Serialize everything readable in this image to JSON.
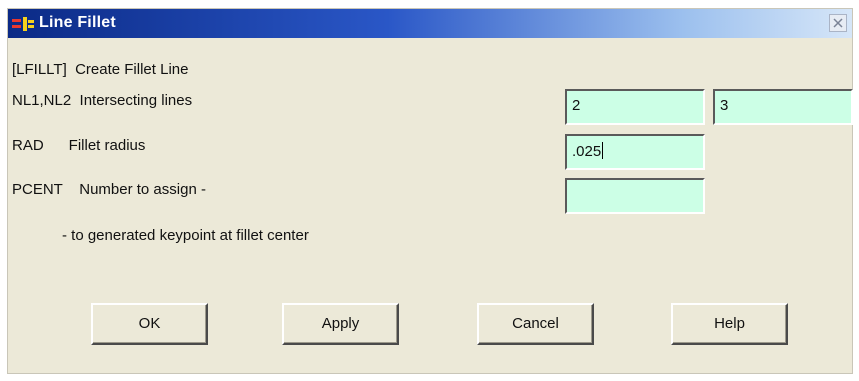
{
  "window": {
    "title": "Line Fillet",
    "title_icon": "ansys-logo-icon",
    "close_icon": "close-icon"
  },
  "header": {
    "command_label": "[LFILLT]  Create Fillet Line"
  },
  "fields": {
    "nl": {
      "label": "NL1,NL2  Intersecting lines",
      "value1": "2",
      "value2": "3"
    },
    "rad": {
      "label": "RAD      Fillet radius",
      "value": ".025"
    },
    "pcent": {
      "label": "PCENT    Number to assign -",
      "value": "",
      "continuation": "- to generated keypoint at fillet center"
    }
  },
  "buttons": {
    "ok": "OK",
    "apply": "Apply",
    "cancel": "Cancel",
    "help": "Help"
  },
  "colors": {
    "field_bg": "#ccffe6",
    "dialog_bg": "#ece9d8",
    "title_start": "#0b2a86",
    "title_end": "#d6e6f8"
  }
}
